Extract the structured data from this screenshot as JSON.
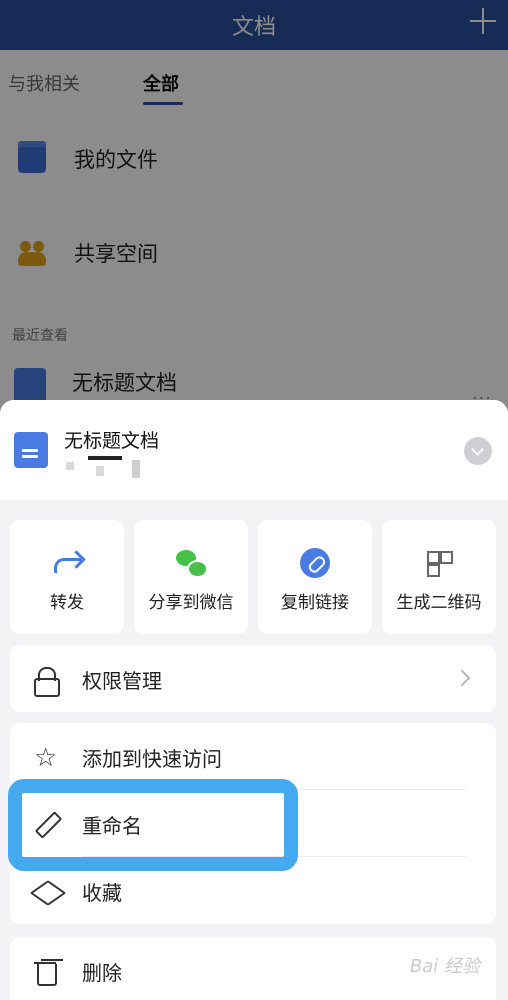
{
  "topbar": {
    "title": "文档"
  },
  "tabs": [
    {
      "label": "与我相关"
    },
    {
      "label": "全部"
    }
  ],
  "entries": [
    {
      "label": "我的文件",
      "icon": "folder-icon"
    },
    {
      "label": "共享空间",
      "icon": "people-icon"
    }
  ],
  "recent": {
    "label": "最近查看",
    "doc_title": "无标题文档",
    "more": "..."
  },
  "sheet": {
    "title": "无标题文档"
  },
  "actions": [
    {
      "label": "转发",
      "icon": "forward-icon"
    },
    {
      "label": "分享到微信",
      "icon": "wechat-icon"
    },
    {
      "label": "复制链接",
      "icon": "link-icon"
    },
    {
      "label": "生成二维码",
      "icon": "qr-icon"
    }
  ],
  "menu": {
    "permission": {
      "label": "权限管理",
      "icon": "lock-icon"
    },
    "quick_access": {
      "label": "添加到快速访问",
      "icon": "star-icon"
    },
    "rename": {
      "label": "重命名",
      "icon": "pencil-icon"
    },
    "favorite": {
      "label": "收藏",
      "icon": "box-icon"
    },
    "delete": {
      "label": "删除",
      "icon": "trash-icon"
    }
  },
  "colors": {
    "topbar": "#2b4f9e",
    "accent": "#4a7be0",
    "highlight": "#45a9ef",
    "wechat": "#47c04a"
  },
  "watermark": "Bai 经验"
}
